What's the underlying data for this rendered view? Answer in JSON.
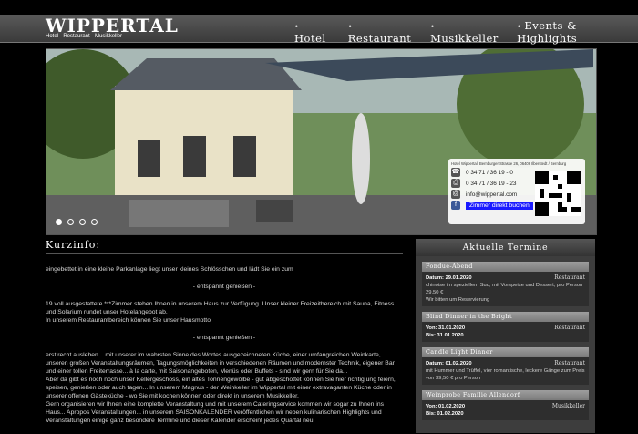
{
  "brand": {
    "logo": "WIPPERTAL",
    "breadcrumb": "Hotel · Restaurant · Musikkeller"
  },
  "nav": [
    "Hotel",
    "Restaurant",
    "Musikkeller",
    "Events & Highlights"
  ],
  "hero_info": {
    "address": "Hotel Wippertal, Bernburger Strasse 26, 06406 Ilberstedt / Bernburg",
    "phone": "0 34 71 / 36 19 - 0",
    "fax": "0 34 71 / 36 19 - 23",
    "email": "info@wippertal.com",
    "book_label": "Zimmer direkt buchen"
  },
  "main": {
    "title": "Kurzinfo:",
    "p1": "eingebettet in eine kleine Parkanlage liegt unser kleines Schlösschen und lädt Sie ein zum",
    "p2": "- entspannt genießen -",
    "p3a": "19 voll ausgestattete ***Zimmer stehen Ihnen in unserem Haus zur Verfügung. Unser kleiner Freizeitbereich mit Sauna, Fitness und Solarium rundet unser Hotelangebot ab.",
    "p3b": "In unserem Restaurantbereich können Sie unser Hausmotto",
    "p4": "- entspannt genießen -",
    "p5": "erst recht ausleben... mit unserer im wahrsten Sinne des Wortes ausgezeichneten Küche, einer umfangreichen Weinkarte, unseren großen Veranstaltungsräumen, Tagungsmöglichkeiten in verschiedenen Räumen und modernster Technik, eigener Bar und einer tollen Freiterrasse... à la carte, mit Saisonangeboten, Menüs oder Buffets - sind wir gern für Sie da...",
    "p6": "Aber da gibt es noch noch unser Kellergeschoss, ein altes Tonnengewölbe - gut abgeschottet können Sie hier richtig ung feiern, speisen, genießen oder auch tagen... In unserem Magnus - der Weinkeller im Wippertal mit einer extravaganten Küche oder in unserer offenen Gästeküche - wo Sie mit kochen können oder direkt in unserem Musikkeller.",
    "p7": "Gern organisieren wir Ihnen eine komplette Veranstaltung und mit unserem Cateringservice kommen wir sogar zu Ihnen ins Haus... Apropos Veranstaltungen... in unserem SAISONKALENDER veröffentlichen wir neben kulinarischen Highlights und Veranstaltungen einige ganz besondere Termine und dieser Kalender erscheint jedes Quartal neu."
  },
  "sidebar": {
    "title": "Aktuelle Termine",
    "events": [
      {
        "title": "Fondue-Abend",
        "cat": "Restaurant",
        "l1": "Datum: 29.01.2020",
        "l2": "chinoise im speziellem Sud, mit Vorspeise und Dessert, pro Person 29,50 €",
        "l3": "Wir bitten um Reservierung"
      },
      {
        "title": "Blind Dinner in the Bright",
        "cat": "Restaurant",
        "l1": "Von: 31.01.2020",
        "l2": "Bis: 31.01.2020",
        "l3": ""
      },
      {
        "title": "Candle Light Dinner",
        "cat": "Restaurant",
        "l1": "Datum: 01.02.2020",
        "l2": "mit Hummer und Trüffel, vier romantische, leckere Gänge zum Preis von 39,50 € pro Person",
        "l3": ""
      },
      {
        "title": "Weinprobe Familie Allendorf",
        "cat": "Musikkeller",
        "l1": "Von: 01.02.2020",
        "l2": "Bis: 01.02.2020",
        "l3": ""
      }
    ]
  }
}
